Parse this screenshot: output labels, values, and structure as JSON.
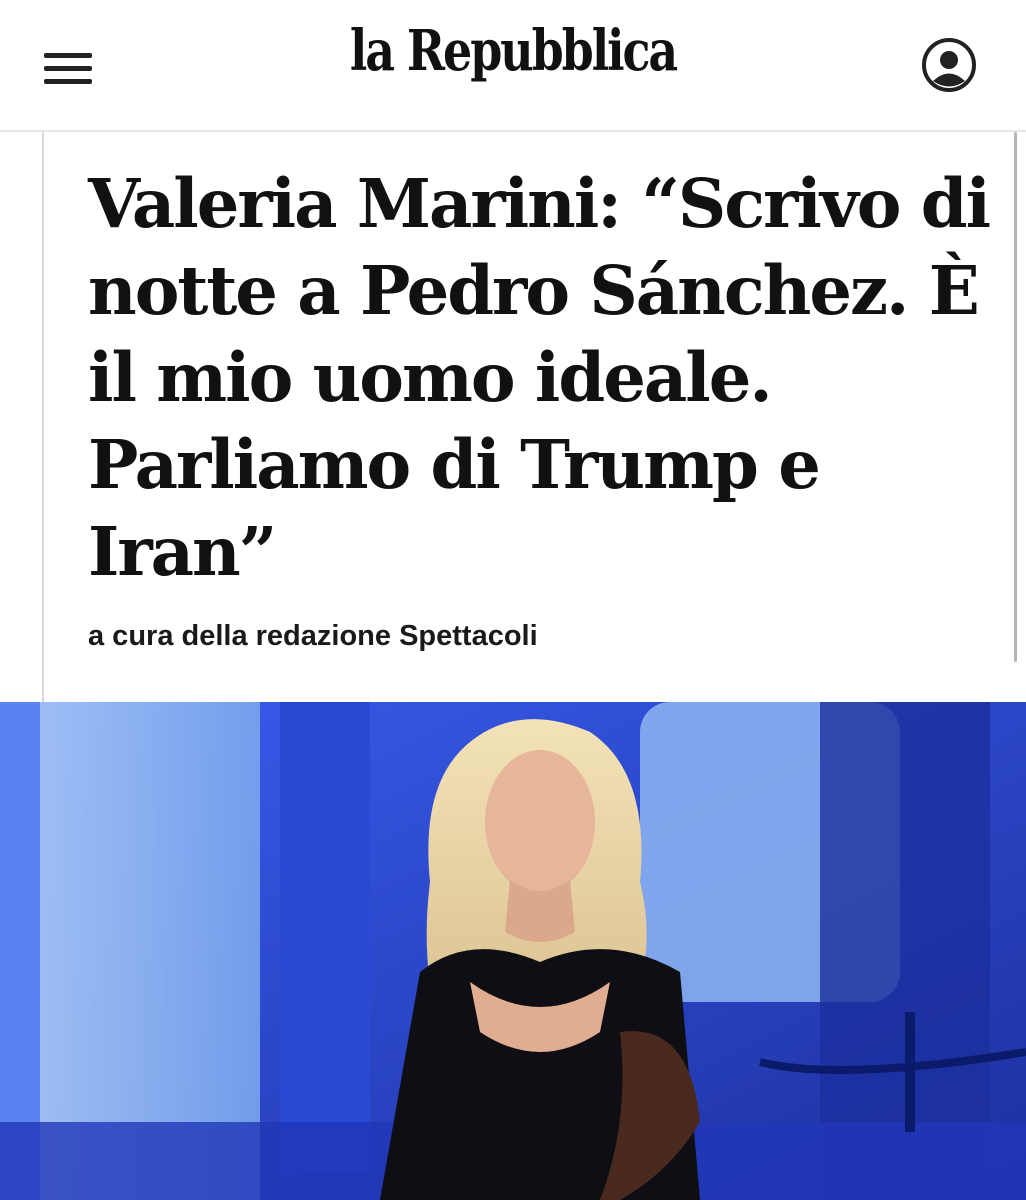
{
  "header": {
    "logo": "la Repubblica",
    "menu_icon": "hamburger-menu-icon",
    "account_icon": "user-account-icon"
  },
  "article": {
    "headline_lines": [
      "Valeria Marini: “Scrivo di",
      "notte a Pedro Sánchez. È",
      "il mio uomo ideale.",
      "Parliamo di Trump e",
      "Iran”"
    ],
    "byline": "a cura della redazione Spettacoli"
  },
  "photo": {
    "subject": "woman-with-blonde-hair-in-black-dress",
    "background_color": "#2f4fd6"
  }
}
